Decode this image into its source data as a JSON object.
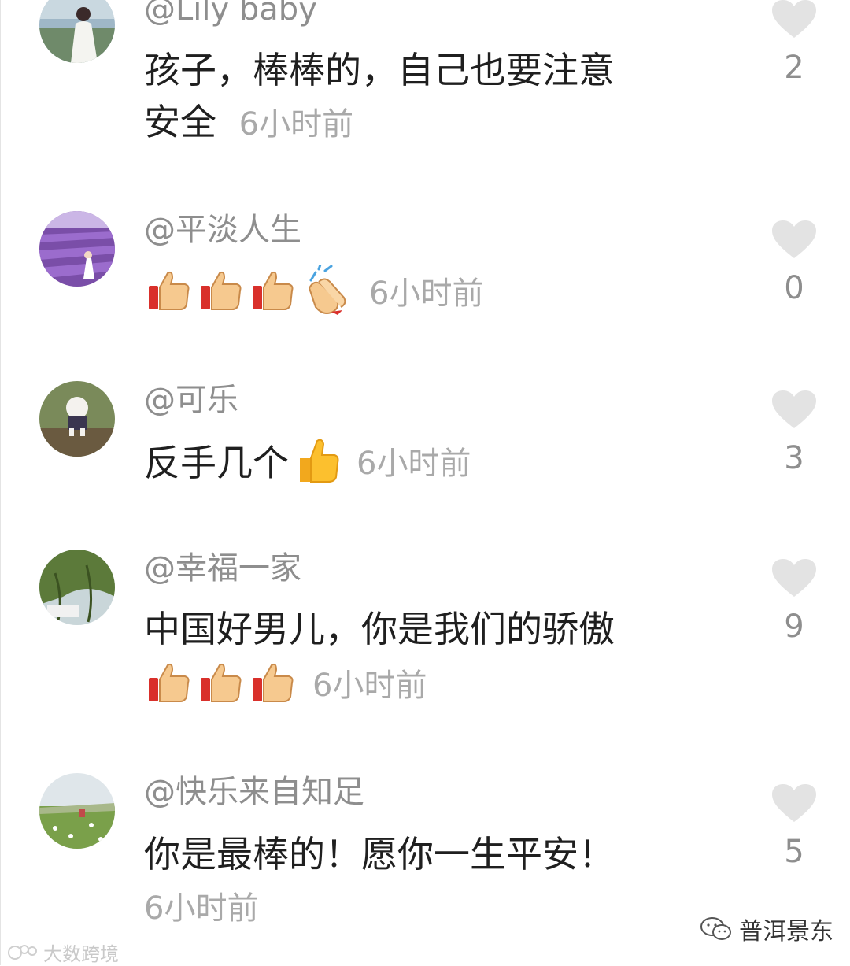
{
  "comments": [
    {
      "username": "@Lily baby",
      "text_line1": "孩子，棒棒的，自己也要注意",
      "text_line2": "安全",
      "time": "6小时前",
      "likes": "2"
    },
    {
      "username": "@平淡人生",
      "text": "",
      "emojis": [
        "thumbs-up",
        "thumbs-up",
        "thumbs-up",
        "clapping-hands"
      ],
      "time": "6小时前",
      "likes": "0"
    },
    {
      "username": "@可乐",
      "text": "反手几个",
      "emojis": [
        "thumbs-up-yellow"
      ],
      "time": "6小时前",
      "likes": "3"
    },
    {
      "username": "@幸福一家",
      "text": "中国好男儿，你是我们的骄傲",
      "emojis": [
        "thumbs-up",
        "thumbs-up",
        "thumbs-up"
      ],
      "time": "6小时前",
      "likes": "9"
    },
    {
      "username": "@快乐来自知足",
      "text": "你是最棒的！愿你一生平安！",
      "time": "6小时前",
      "likes": "5"
    }
  ],
  "icons": {
    "like": "heart-icon",
    "avatar": "avatar-image"
  },
  "colors": {
    "username": "#8e8e8e",
    "body": "#1f1f1f",
    "time": "#a9a9a9",
    "heart": "#e3e3e3"
  },
  "watermarks": {
    "left": "大数跨境",
    "right": "普洱景东"
  }
}
